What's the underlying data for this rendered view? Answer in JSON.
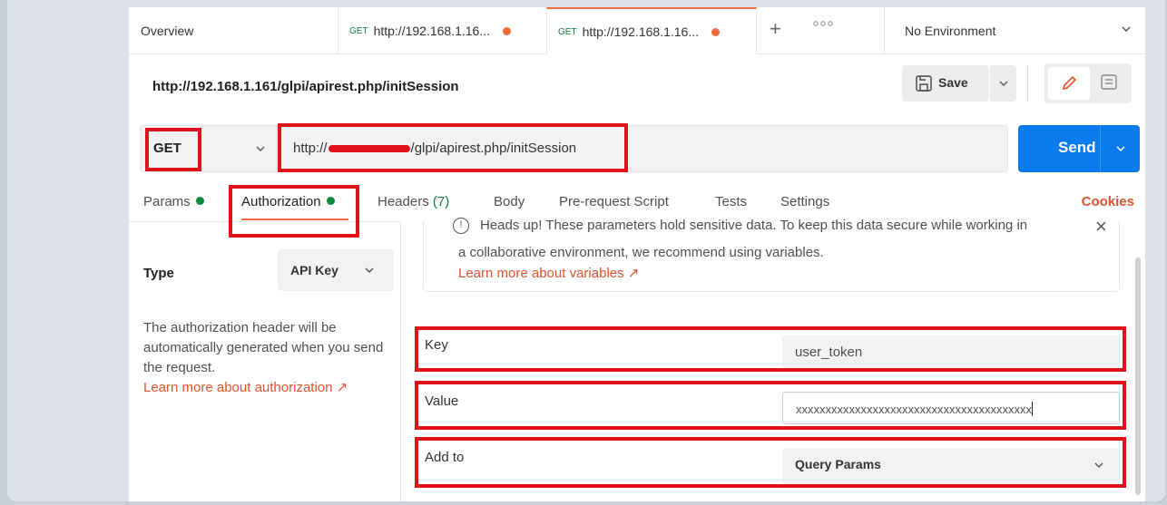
{
  "tabs": {
    "overview": "Overview",
    "request_tabs": [
      {
        "method": "GET",
        "url": "http://192.168.1.16..."
      },
      {
        "method": "GET",
        "url": "http://192.168.1.16..."
      }
    ],
    "environment": "No Environment"
  },
  "request": {
    "title": "http://192.168.1.161/glpi/apirest.php/initSession",
    "save_label": "Save",
    "method": "GET",
    "url_prefix": "http://",
    "url_suffix": "/glpi/apirest.php/initSession",
    "send_label": "Send"
  },
  "subtabs": {
    "params": "Params",
    "authorization": "Authorization",
    "headers": "Headers",
    "headers_count": "(7)",
    "body": "Body",
    "prerequest": "Pre-request Script",
    "tests": "Tests",
    "settings": "Settings",
    "cookies": "Cookies"
  },
  "auth": {
    "type_label": "Type",
    "type_value": "API Key",
    "description": "The authorization header will be automatically generated when you send the request.",
    "learn_link": "Learn more about authorization ↗",
    "notice_line1": "Heads up! These parameters hold sensitive data. To keep this data secure while working in",
    "notice_line2": "a collaborative environment, we recommend using variables.",
    "notice_link": "Learn more about variables ↗",
    "key_label": "Key",
    "key_value": "user_token",
    "value_label": "Value",
    "value_value": "xxxxxxxxxxxxxxxxxxxxxxxxxxxxxxxxxxxxxxxx",
    "addto_label": "Add to",
    "addto_value": "Query Params"
  },
  "colors": {
    "accent_orange": "#f26b3a",
    "send_blue": "#097bed",
    "highlight_red": "#e0131d",
    "status_green": "#0f8a3e"
  }
}
